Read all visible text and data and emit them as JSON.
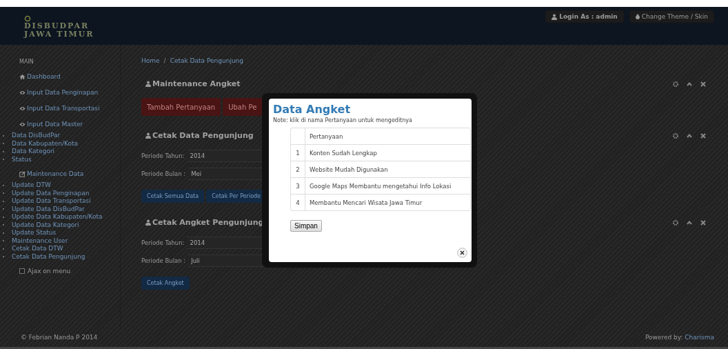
{
  "header": {
    "logo_lines": [
      "DISBUDPAR",
      "JAWA TIMUR"
    ],
    "user_menu": "Login As : admin",
    "theme_menu": "Change Theme / Skin"
  },
  "sidebar": {
    "heading": "MAIN",
    "sections": [
      {
        "kind": "dashboard",
        "label": "Dashboard"
      },
      {
        "kind": "input",
        "label": "Input Data Penginapan"
      },
      {
        "kind": "input",
        "label": "Input Data Transportasi"
      },
      {
        "kind": "input",
        "label": "Input Data Master",
        "children": [
          "Data DisBudPar",
          "Data Kabupaten/Kota",
          "Data Kategori",
          "Status"
        ]
      },
      {
        "kind": "maintenance",
        "label": "Maintenance Data",
        "children": [
          "Update DTW",
          "Update Data Penginapan",
          "Update Data Transportasi",
          "Update Data DisBudPar",
          "Update Data Kabupaten/Kota",
          "Update Data Kategori",
          "Update Status",
          "Maintenance User",
          "Cetak Data DTW",
          "Cetak Data Pengunjung"
        ]
      }
    ],
    "ajax_toggle": {
      "label": "Ajax on menu",
      "checked": false
    }
  },
  "breadcrumb": {
    "items": [
      "Home",
      "Cetak Data Pengunjung"
    ],
    "separator": "/"
  },
  "panels": [
    {
      "title": "Maintenance Angket",
      "buttons": [
        {
          "label": "Tambah Pertanyaan",
          "kind": "danger"
        },
        {
          "label": "Ubah Pe",
          "kind": "danger"
        }
      ]
    },
    {
      "title": "Cetak Data Pengunjung",
      "fields": [
        {
          "label": "Periode Tahun:",
          "value": "2014"
        },
        {
          "label": "Periode Bulan :",
          "value": "Mei"
        }
      ],
      "buttons": [
        {
          "label": "Cetak Semua Data",
          "kind": "primary"
        },
        {
          "label": "Cetak Per Periode",
          "kind": "primary"
        }
      ]
    },
    {
      "title": "Cetak Angket Pengunjung",
      "fields": [
        {
          "label": "Periode Tahun:",
          "value": "2014"
        },
        {
          "label": "Periode Bulan :",
          "value": "Juli"
        }
      ],
      "buttons": [
        {
          "label": "Cetak Angket",
          "kind": "primary"
        }
      ]
    }
  ],
  "footer": {
    "copyright": "© Febrian Nanda P 2014",
    "powered_by": "Powered by:",
    "powered_link": "Charisma"
  },
  "modal": {
    "title": "Data Angket",
    "note": "Note: klik di nama Pertanyaan untuk mengeditnya",
    "columns": [
      "Pertanyaan"
    ],
    "rows": [
      {
        "no": "1",
        "text": "Konten Sudah Lengkap"
      },
      {
        "no": "2",
        "text": "Website Mudah Digunakan"
      },
      {
        "no": "3",
        "text": "Google Maps Membantu mengetahui Info Lokasi"
      },
      {
        "no": "4",
        "text": "Membantu Mencari Wisata Jawa Timur"
      }
    ],
    "save_button": "Simpan"
  }
}
